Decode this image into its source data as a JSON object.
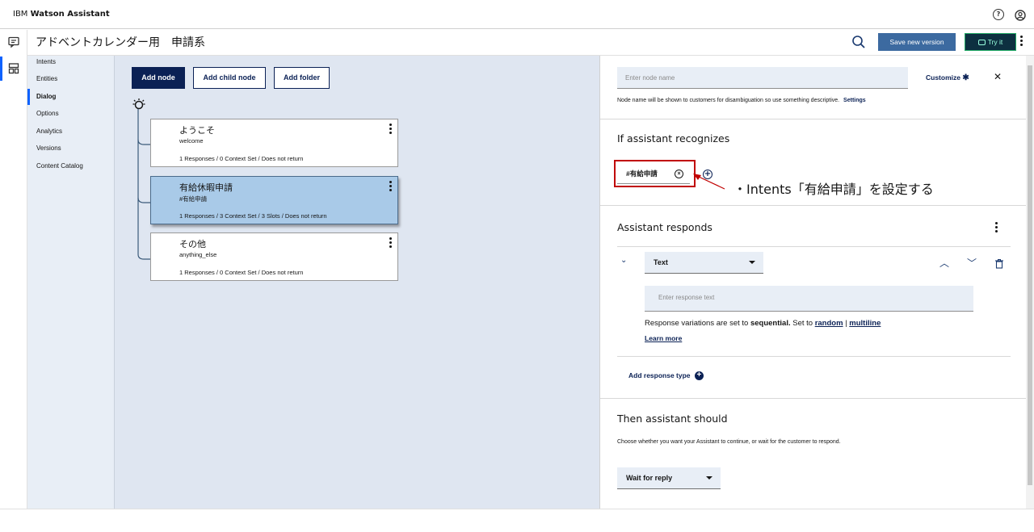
{
  "app": {
    "brand_prefix": "IBM",
    "brand_name": "Watson Assistant",
    "help_icon": "help-icon",
    "user_icon": "user-icon"
  },
  "skill": {
    "title": "アドベントカレンダー用　申請系",
    "save_label": "Save new version",
    "try_label": "Try it"
  },
  "sidenav": {
    "items": [
      {
        "label": "Intents"
      },
      {
        "label": "Entities"
      },
      {
        "label": "Dialog",
        "active": true
      },
      {
        "label": "Options"
      },
      {
        "label": "Analytics"
      },
      {
        "label": "Versions"
      },
      {
        "label": "Content Catalog"
      }
    ]
  },
  "canvas": {
    "add_node": "Add node",
    "add_child_node": "Add child node",
    "add_folder": "Add folder",
    "nodes": [
      {
        "title": "ようこそ",
        "condition": "welcome",
        "meta": "1 Responses / 0 Context Set / Does not return",
        "selected": false
      },
      {
        "title": "有給休暇申請",
        "condition": "#有給申請",
        "meta": "1 Responses / 3 Context Set / 3 Slots / Does not return",
        "selected": true
      },
      {
        "title": "その他",
        "condition": "anything_else",
        "meta": "1 Responses / 0 Context Set / Does not return",
        "selected": false
      }
    ]
  },
  "panel": {
    "node_name_placeholder": "Enter node name",
    "customize_label": "Customize",
    "node_name_help": "Node name will be shown to customers for disambiguation so use something descriptive.",
    "settings_link": "Settings",
    "recognizes_title": "If assistant recognizes",
    "condition_tag": "#有給申請",
    "responds_title": "Assistant responds",
    "response_type": "Text",
    "response_placeholder": "Enter response text",
    "variations_prefix": "Response variations are set to",
    "variations_mode": "sequential.",
    "variations_set_to": "Set to",
    "random_link": "random",
    "separator": "|",
    "multiline_link": "multiline",
    "learn_more": "Learn more",
    "add_response_type": "Add response type",
    "then_title": "Then assistant should",
    "then_help": "Choose whether you want your Assistant to continue, or wait for the customer to respond.",
    "then_select": "Wait for reply"
  },
  "annotation": {
    "text": "・Intents「有給申請」を設定する",
    "color": "#c00000"
  }
}
